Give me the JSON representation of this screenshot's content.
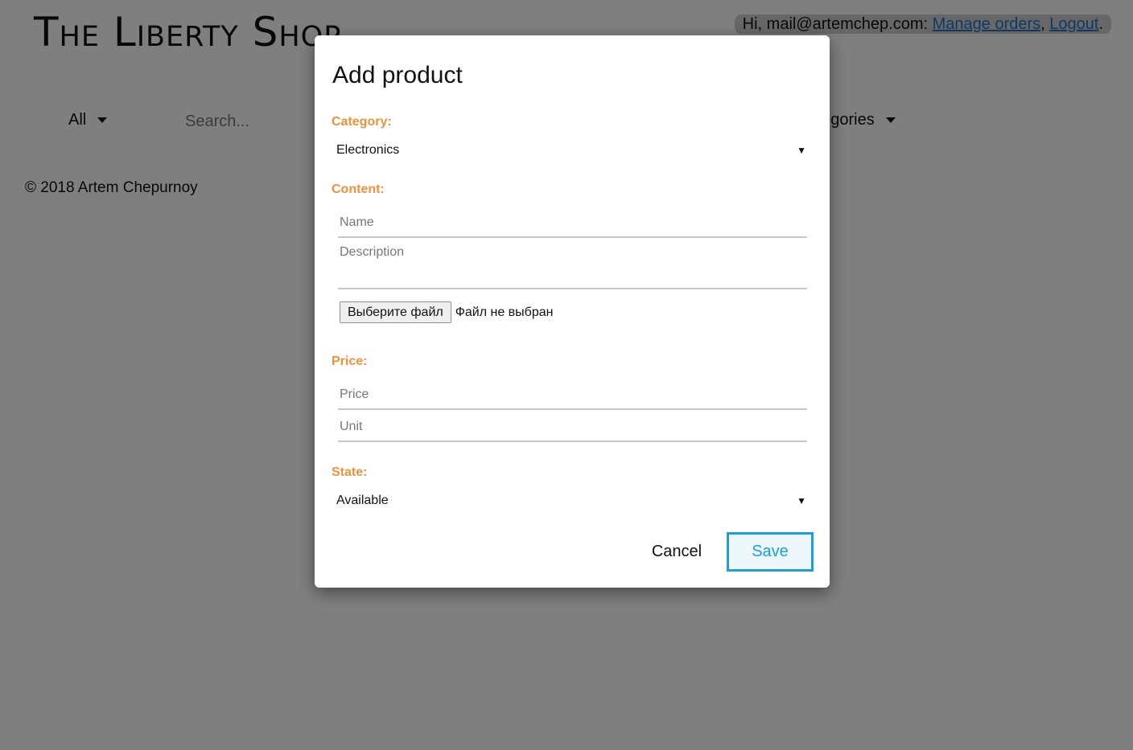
{
  "site": {
    "title": "The Liberty Shop",
    "user_bar": {
      "greeting": "Hi,",
      "email": "mail@artemchep.com",
      "colon": ":",
      "manage_orders": "Manage orders",
      "comma": ",",
      "logout": "Logout",
      "period": "."
    },
    "nav": {
      "filter_label": "All",
      "search_placeholder": "Search...",
      "categories_label": "Categories"
    },
    "footer": "© 2018 Artem Chepurnoy"
  },
  "modal": {
    "title": "Add product",
    "category": {
      "label": "Category:",
      "selected": "Electronics"
    },
    "content": {
      "label": "Content:",
      "name_placeholder": "Name",
      "description_placeholder": "Description",
      "file_button": "Выберите файл",
      "file_status": "Файл не выбран"
    },
    "price": {
      "label": "Price:",
      "price_placeholder": "Price",
      "unit_placeholder": "Unit"
    },
    "state": {
      "label": "State:",
      "selected": "Available"
    },
    "actions": {
      "cancel": "Cancel",
      "save": "Save"
    }
  },
  "colors": {
    "accent": "#1a9fe0",
    "section_label": "#f0923a",
    "link": "#1a73c8",
    "overlay": "#808080"
  }
}
